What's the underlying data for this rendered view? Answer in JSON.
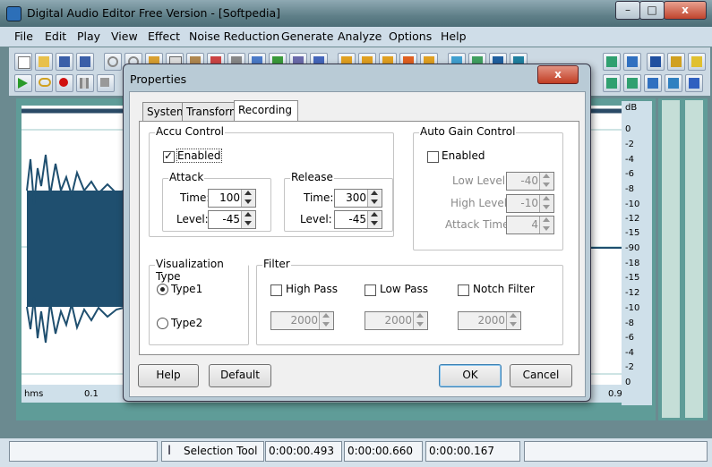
{
  "window": {
    "title": "Digital Audio Editor Free Version - [Softpedia]",
    "min": "–",
    "max": "□",
    "close": "x"
  },
  "menu": [
    "File",
    "Edit",
    "Play",
    "View",
    "Effect",
    "Noise Reduction",
    "Generate",
    "Analyze",
    "Options",
    "Help"
  ],
  "ruler": {
    "labels": [
      "hms",
      "0.1",
      "0.9"
    ]
  },
  "db_scale": [
    "dB",
    "0",
    "-2",
    "-4",
    "-6",
    "-8",
    "-10",
    "-12",
    "-15",
    "-90",
    "-18",
    "-15",
    "-12",
    "-10",
    "-8",
    "-6",
    "-4",
    "-2",
    "0"
  ],
  "status": {
    "tool": "Selection Tool",
    "start": "0:00:00.493",
    "end": "0:00:00.660",
    "length": "0:00:00.167"
  },
  "dialog": {
    "title": "Properties",
    "close": "x",
    "tabs": [
      "System",
      "Transform",
      "Recording"
    ],
    "accu": {
      "title": "Accu Control",
      "enabled_label": "Enabled",
      "enabled": true,
      "attack": {
        "title": "Attack",
        "time_label": "Time:",
        "time": "100",
        "level_label": "Level:",
        "level": "-45"
      },
      "release": {
        "title": "Release",
        "time_label": "Time:",
        "time": "300",
        "level_label": "Level:",
        "level": "-45"
      }
    },
    "agc": {
      "title": "Auto Gain Control",
      "enabled_label": "Enabled",
      "enabled": false,
      "low_label": "Low Level:",
      "low": "-40",
      "high_label": "High Level:",
      "high": "-10",
      "attack_label": "Attack Time:",
      "attack": "4"
    },
    "vis": {
      "title": "Visualization Type",
      "type1": "Type1",
      "type2": "Type2",
      "selected": "Type1"
    },
    "filter": {
      "title": "Filter",
      "high_label": "High Pass",
      "high": "2000",
      "low_label": "Low Pass",
      "low": "2000",
      "notch_label": "Notch Filter",
      "notch": "2000"
    },
    "buttons": {
      "help": "Help",
      "default": "Default",
      "ok": "OK",
      "cancel": "Cancel"
    }
  }
}
